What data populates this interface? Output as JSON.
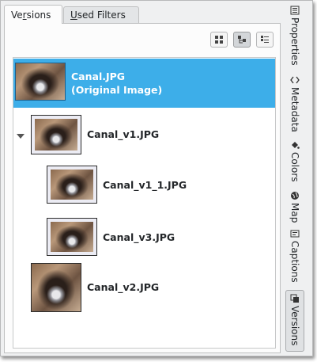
{
  "tabs": [
    {
      "label": "Versions",
      "active": true
    },
    {
      "label": "Used Filters",
      "active": false
    }
  ],
  "view_buttons": [
    {
      "name": "icon-view-button",
      "checked": false
    },
    {
      "name": "tree-view-button",
      "checked": true
    },
    {
      "name": "list-view-button",
      "checked": false
    }
  ],
  "versions": [
    {
      "label_line1": "Canal.JPG",
      "label_line2": "(Original Image)",
      "selected": true,
      "level": 0
    },
    {
      "label": "Canal_v1.JPG",
      "level": 0,
      "expanded": true
    },
    {
      "label": "Canal_v1_1.JPG",
      "level": 1
    },
    {
      "label": "Canal_v3.JPG",
      "level": 1
    },
    {
      "label": "Canal_v2.JPG",
      "level": 0
    }
  ],
  "sidebar": {
    "tabs": [
      {
        "label": "Properties",
        "icon": "properties-icon"
      },
      {
        "label": "Metadata",
        "icon": "metadata-icon"
      },
      {
        "label": "Colors",
        "icon": "colors-icon"
      },
      {
        "label": "Map",
        "icon": "map-icon"
      },
      {
        "label": "Captions",
        "icon": "captions-icon"
      },
      {
        "label": "Versions",
        "icon": "versions-icon",
        "active": true
      }
    ]
  },
  "colors": {
    "selection": "#3daee9",
    "window_bg": "#eff0f1"
  }
}
